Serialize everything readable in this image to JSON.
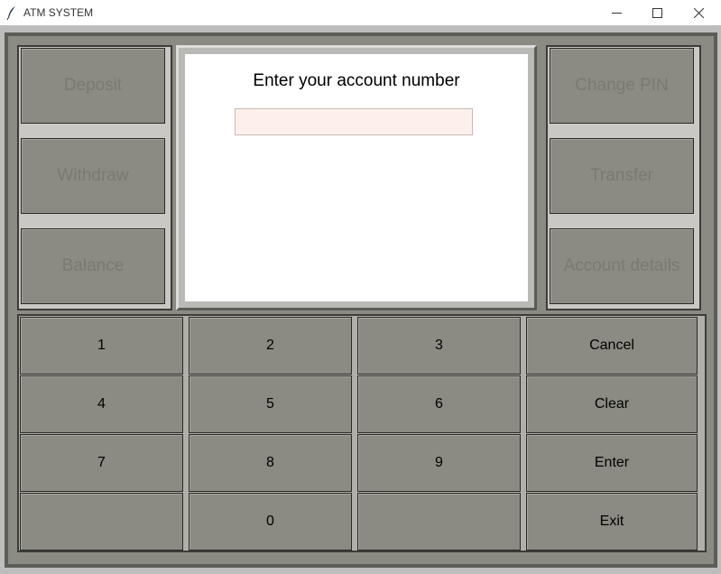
{
  "window": {
    "title": "ATM SYSTEM",
    "controls": [
      "minimize",
      "maximize",
      "close"
    ]
  },
  "side_left": [
    {
      "label": "Deposit"
    },
    {
      "label": "Withdraw"
    },
    {
      "label": "Balance"
    }
  ],
  "side_right": [
    {
      "label": "Change PIN"
    },
    {
      "label": "Transfer"
    },
    {
      "label": "Account details"
    }
  ],
  "screen": {
    "prompt": "Enter your account number",
    "account_input": {
      "value": "",
      "placeholder": ""
    }
  },
  "keypad": {
    "rows": [
      [
        "1",
        "2",
        "3",
        "Cancel"
      ],
      [
        "4",
        "5",
        "6",
        "Clear"
      ],
      [
        "7",
        "8",
        "9",
        "Enter"
      ],
      [
        "",
        "0",
        "",
        "Exit"
      ]
    ]
  }
}
